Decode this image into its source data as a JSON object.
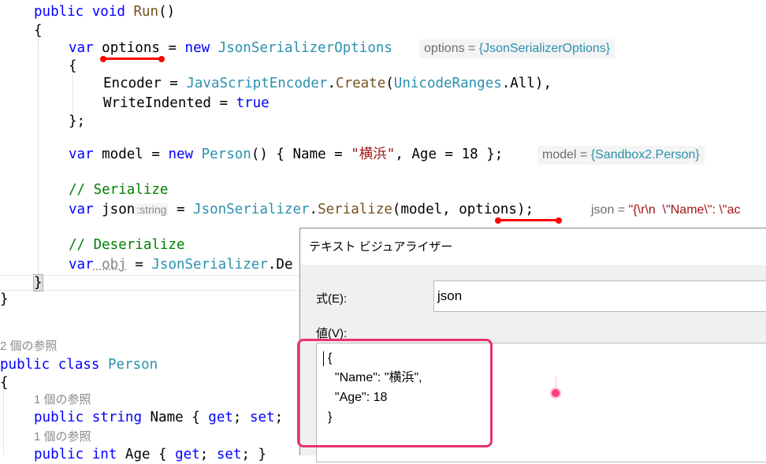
{
  "editor": {
    "method_signature": {
      "kw": "public",
      "type": "void",
      "name": "Run",
      "parens": "()"
    },
    "open_brace": "{",
    "options_line": {
      "kw": "var",
      "name": "options",
      "eq": " = ",
      "new": "new",
      "type": "JsonSerializerOptions"
    },
    "options_tip": {
      "name": "options = ",
      "value": "{JsonSerializerOptions}"
    },
    "init_open": "{",
    "encoder_line": {
      "prop": "Encoder = ",
      "type": "JavaScriptEncoder",
      "dot": ".",
      "method": "Create",
      "open": "(",
      "arg_type": "UnicodeRanges",
      "arg_rest": ".All),"
    },
    "indented_line": {
      "prop": "WriteIndented = ",
      "value": "true"
    },
    "init_close": "};",
    "model_line": {
      "kw": "var",
      "rest1": " model = ",
      "new": "new",
      "type": "Person",
      "parens": "()",
      "rest2": " { Name = ",
      "str": "\"横浜\"",
      "rest3": ", Age = 18 };"
    },
    "model_tip": {
      "name": "model = ",
      "value": "{Sandbox2.Person}"
    },
    "comment_serialize": "// Serialize",
    "json_line": {
      "kw": "var",
      "name": " json",
      "inlay": ":string",
      "eq": " = ",
      "type": "JsonSerializer",
      "dot": ".",
      "method": "Serialize",
      "args": "(model, options);"
    },
    "json_tip": {
      "name": "json = ",
      "value": "\"{\\r\\n  \\\"Name\\\": \\\"ac"
    },
    "comment_deserialize": "// Deserialize",
    "obj_line": {
      "kw": "var",
      "name": " obj",
      "eq": " = ",
      "type": "JsonSerializer",
      "rest": ".De"
    },
    "close_brace_method": "}",
    "close_brace_class_outer": "}",
    "refs_2": "2 個の参照",
    "class_line": {
      "kw1": "public",
      "kw2": "class",
      "type": "Person"
    },
    "class_open": "{",
    "refs_1a": "1 個の参照",
    "name_prop": {
      "kw1": "public",
      "kw2": "string",
      "rest": " Name { ",
      "get": "get",
      "semi": "; ",
      "set": "set",
      "end": ";"
    },
    "refs_1b": "1 個の参照",
    "age_prop": {
      "kw1": "public",
      "kw2": "int",
      "rest": " Age { ",
      "get": "get",
      "semi": "; ",
      "set": "set",
      "end": "; }"
    }
  },
  "dialog": {
    "title": "テキスト ビジュアライザー",
    "expression_label": "式(E):",
    "expression_value": "json",
    "value_label": "値(V):",
    "value_text": "{\n  \"Name\": \"横浜\",\n  \"Age\": 18\n}"
  },
  "colors": {
    "keyword": "#0000ff",
    "type": "#2b91af",
    "method": "#74531f",
    "string": "#a31515",
    "comment": "#008000",
    "highlight": "#e8336b",
    "underline": "#ff0000"
  }
}
